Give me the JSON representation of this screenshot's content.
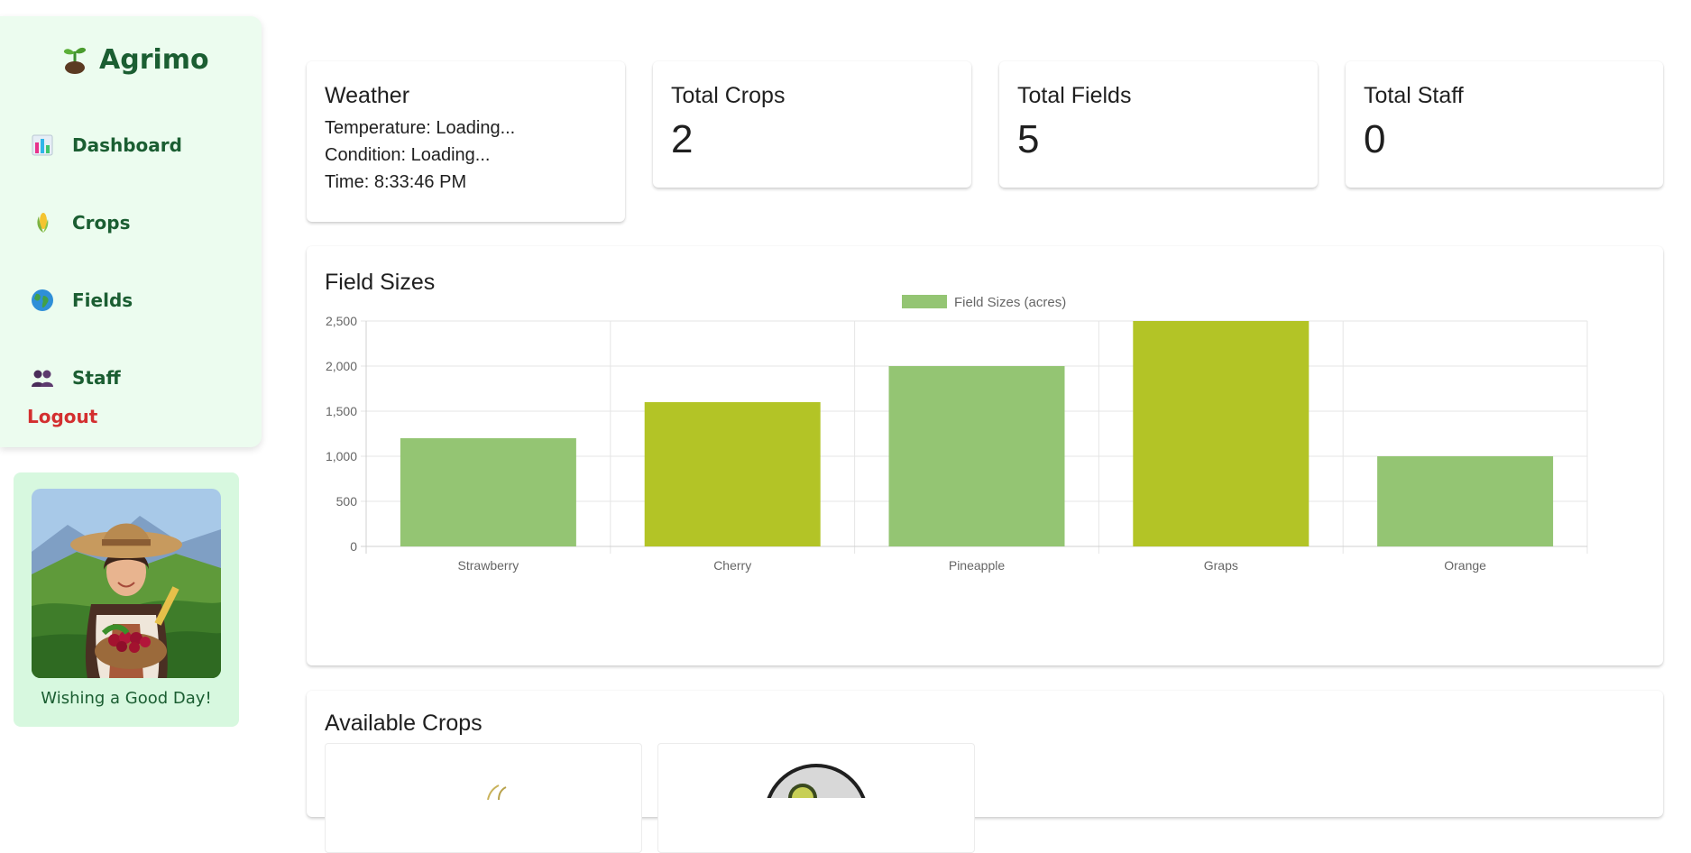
{
  "brand": {
    "name": "Agrimo"
  },
  "nav": {
    "items": [
      {
        "label": "Dashboard",
        "icon": "bar-chart-icon"
      },
      {
        "label": "Crops",
        "icon": "corn-icon"
      },
      {
        "label": "Fields",
        "icon": "globe-icon"
      },
      {
        "label": "Staff",
        "icon": "people-icon"
      }
    ],
    "logout": "Logout"
  },
  "greeting": {
    "text": "Wishing a Good Day!"
  },
  "weather": {
    "title": "Weather",
    "temperature": "Temperature: Loading...",
    "condition": "Condition: Loading...",
    "time": "Time: 8:33:46 PM"
  },
  "stats": [
    {
      "title": "Total Crops",
      "value": "2"
    },
    {
      "title": "Total Fields",
      "value": "5"
    },
    {
      "title": "Total Staff",
      "value": "0"
    }
  ],
  "chart_section": {
    "title": "Field Sizes"
  },
  "chart_data": {
    "type": "bar",
    "categories": [
      "Strawberry",
      "Cherry",
      "Pineapple",
      "Graps",
      "Orange"
    ],
    "series": [
      {
        "name": "Field Sizes (acres)",
        "values": [
          1200,
          1600,
          2000,
          2500,
          1000
        ]
      }
    ],
    "bar_colors": [
      "#94c573",
      "#b3c426",
      "#94c573",
      "#b3c426",
      "#94c573"
    ],
    "legend_color": "#94c573",
    "ylim": [
      0,
      2500
    ],
    "yticks": [
      0,
      500,
      1000,
      1500,
      2000,
      2500
    ],
    "ytick_labels": [
      "0",
      "500",
      "1,000",
      "1,500",
      "2,000",
      "2,500"
    ],
    "grid": true,
    "legend_position": "top-center"
  },
  "crops_section": {
    "title": "Available Crops"
  }
}
